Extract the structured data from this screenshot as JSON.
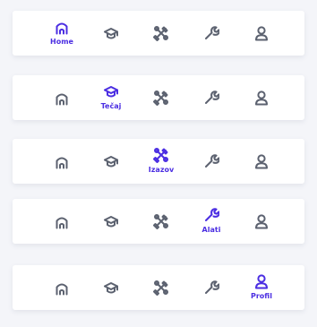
{
  "colors": {
    "active": "#4b2ee2",
    "inactive": "#5c6270",
    "background": "#f4f5f9",
    "bar": "#ffffff"
  },
  "nav_items": [
    {
      "key": "home",
      "label": "Home",
      "icon": "home-icon"
    },
    {
      "key": "tecaj",
      "label": "Tečaj",
      "icon": "graduation-cap-icon"
    },
    {
      "key": "izazov",
      "label": "Izazov",
      "icon": "tools-cross-icon"
    },
    {
      "key": "alati",
      "label": "Alati",
      "icon": "wrench-icon"
    },
    {
      "key": "profil",
      "label": "Profil",
      "icon": "user-icon"
    }
  ],
  "bars": [
    {
      "active_index": 0
    },
    {
      "active_index": 1
    },
    {
      "active_index": 2
    },
    {
      "active_index": 3
    },
    {
      "active_index": 4
    }
  ]
}
